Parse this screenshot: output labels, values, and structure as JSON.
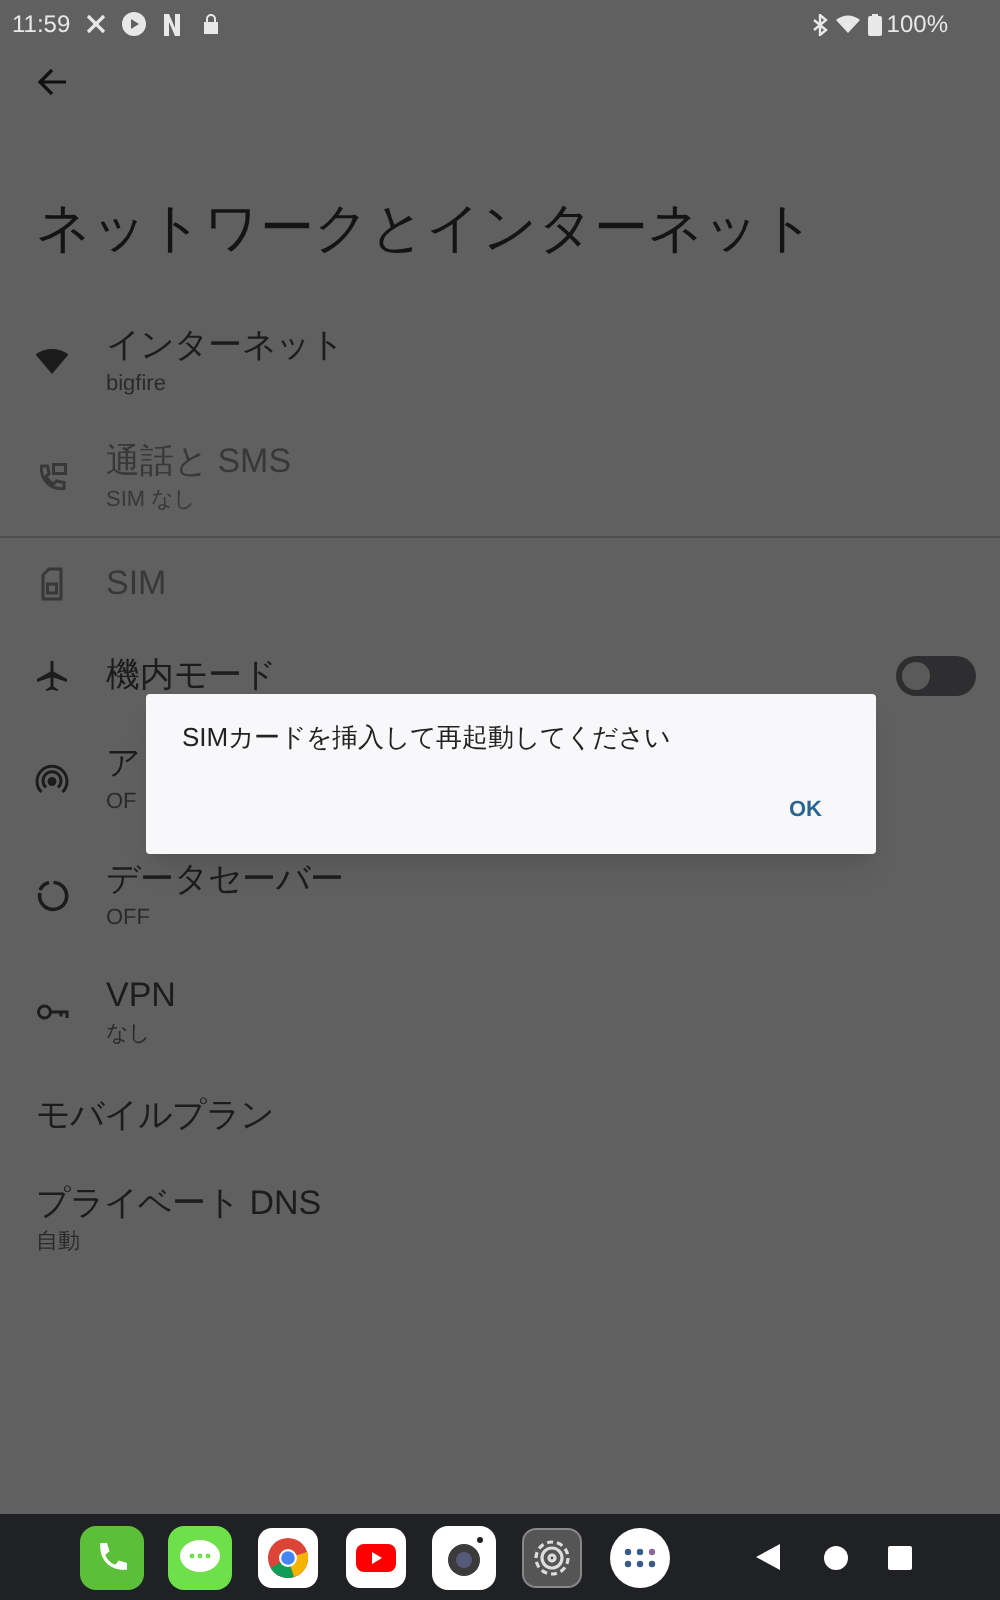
{
  "status_bar": {
    "time": "11:59",
    "battery": "100%"
  },
  "title": "ネットワークとインターネット",
  "sections": [
    [
      {
        "title": "インターネット",
        "subtitle": "bigfire",
        "disabled": false
      },
      {
        "title": "通話と SMS",
        "subtitle": "SIM なし",
        "disabled": true
      }
    ],
    [
      {
        "title": "SIM",
        "disabled": true
      },
      {
        "title": "機内モード",
        "disabled": false,
        "toggle": {
          "on": false
        }
      },
      {
        "title": "ア",
        "subtitle": "OF",
        "disabled": false
      },
      {
        "title": "データセーバー",
        "subtitle": "OFF",
        "disabled": false
      },
      {
        "title": "VPN",
        "subtitle": "なし",
        "disabled": false
      },
      {
        "title": "モバイルプラン",
        "disabled": false
      },
      {
        "title": "プライベート DNS",
        "subtitle": "自動",
        "disabled": false
      }
    ]
  ],
  "dialog": {
    "message": "SIMカードを挿入して再起動してください",
    "button": "OK"
  }
}
